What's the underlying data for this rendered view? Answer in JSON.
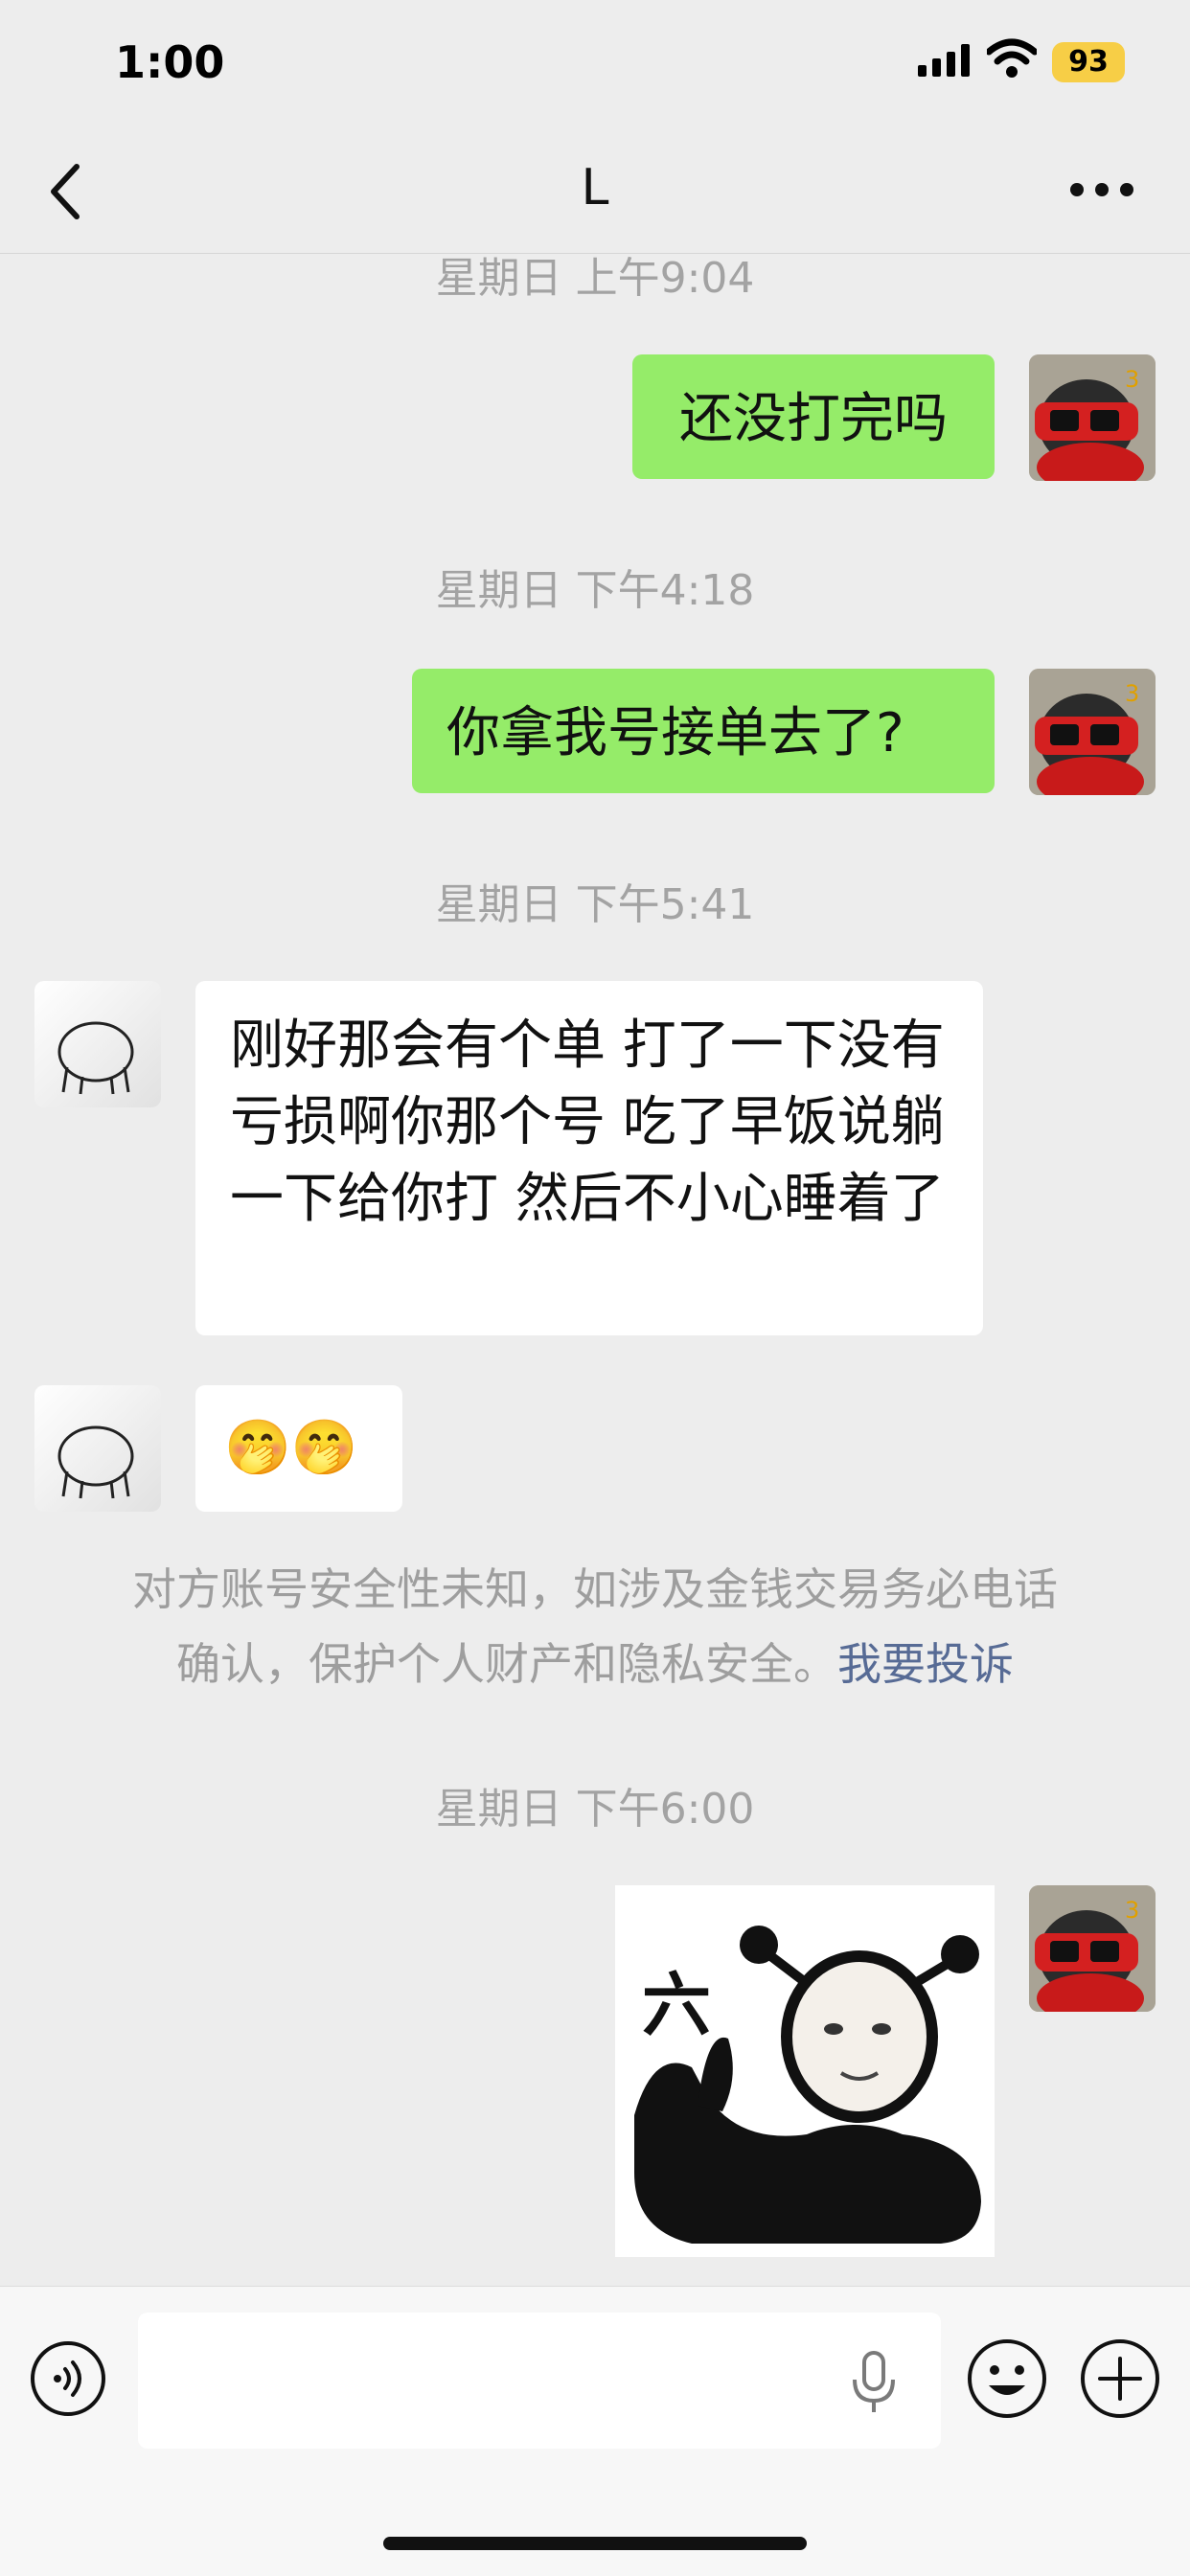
{
  "status_bar": {
    "time": "1:00",
    "battery": "93"
  },
  "nav": {
    "title": "L"
  },
  "messages": {
    "ts1": "星期日 上午9:04",
    "msg1": "还没打完吗",
    "ts2": "星期日 下午4:18",
    "msg2": "你拿我号接单去了?",
    "ts3": "星期日 下午5:41",
    "msg3": "刚好那会有个单 打了一下没有亏损啊你那个号 吃了早饭说躺一下给你打 然后不小心睡着了",
    "msg4": "🤭🤭",
    "ts4": "星期日 下午6:00",
    "sticker_text": "六"
  },
  "notice": {
    "line1": "对方账号安全性未知，如涉及金钱交易务必电话",
    "line2": "确认，保护个人财产和隐私安全。",
    "link": "我要投诉"
  },
  "input": {
    "placeholder": ""
  },
  "colors": {
    "bubble_me": "#95ec69",
    "bubble_them": "#ffffff",
    "background": "#ededed",
    "link": "#576b95",
    "battery": "#f7ce46"
  },
  "icons": [
    "back-icon",
    "more-icon",
    "signal-icon",
    "wifi-icon",
    "voice-icon",
    "mic-icon",
    "emoji-icon",
    "plus-icon"
  ]
}
